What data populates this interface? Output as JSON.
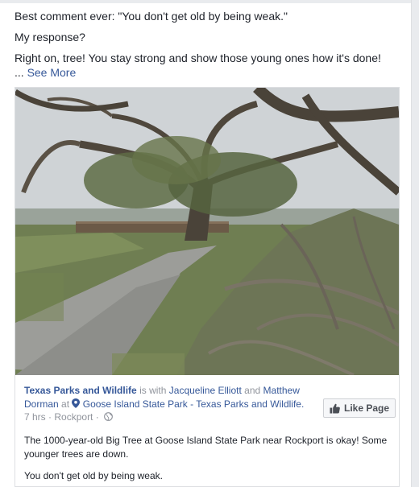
{
  "post": {
    "text_line_1": "Best comment ever: \"You don't get old by being weak.\"",
    "text_line_2": "My response?",
    "text_line_3": "Right on, tree! You stay strong and show those young ones how it's done!",
    "ellipsis": "...",
    "see_more": "See More"
  },
  "shared": {
    "photo_icon": "photo-of-big-tree",
    "page_name": "Texas Parks and Wildlife",
    "is_with": "is with",
    "person_1": "Jacqueline Elliott",
    "and": "and",
    "person_2": "Matthew Dorman",
    "at": "at",
    "location": "Goose Island State Park - Texas Parks and Wildlife.",
    "time": "7 hrs",
    "separator": "·",
    "place": "Rockport",
    "like_page_label": "Like Page",
    "description_1": "The 1000-year-old Big Tree at Goose Island State Park near Rockport is okay! Some younger trees are down.",
    "description_2": "You don't get old by being weak."
  },
  "colors": {
    "link": "#365899",
    "meta": "#90949c",
    "text": "#1d2129",
    "background": "#e9ebee"
  }
}
